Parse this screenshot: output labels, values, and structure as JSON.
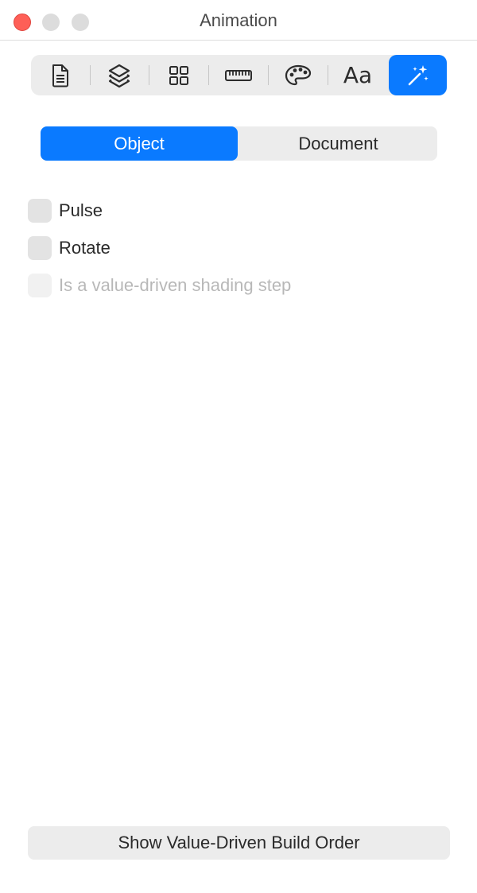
{
  "window": {
    "title": "Animation"
  },
  "toolbar": {
    "tools": [
      {
        "icon": "document-icon"
      },
      {
        "icon": "layers-icon"
      },
      {
        "icon": "grid-icon"
      },
      {
        "icon": "ruler-icon"
      },
      {
        "icon": "palette-icon"
      },
      {
        "icon": "text-style-icon",
        "label": "Aa"
      },
      {
        "icon": "magic-wand-icon",
        "active": true
      }
    ]
  },
  "segmented": {
    "object_label": "Object",
    "document_label": "Document",
    "selected": "Object"
  },
  "options": [
    {
      "label": "Pulse",
      "checked": false,
      "enabled": true
    },
    {
      "label": "Rotate",
      "checked": false,
      "enabled": true
    },
    {
      "label": "Is a value-driven shading step",
      "checked": false,
      "enabled": false
    }
  ],
  "footer": {
    "button_label": "Show Value-Driven Build Order"
  },
  "colors": {
    "accent": "#0a7aff",
    "close": "#fe5f57",
    "inactive_traffic": "#dcdcdc"
  }
}
